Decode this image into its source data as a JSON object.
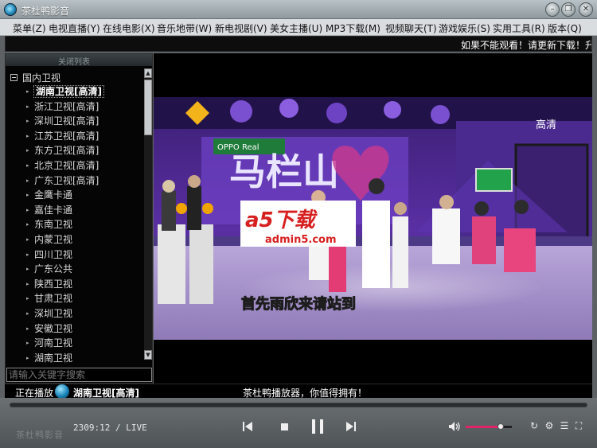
{
  "window": {
    "title": "茶杜鸭影音",
    "buttons": {
      "minimize": "–",
      "restore": "❐",
      "close": "✕"
    }
  },
  "menu": [
    "菜单(Z)",
    "电视直播(Y)",
    "在线电影(X)",
    "音乐地带(W)",
    "新电视剧(V)",
    "美女主播(U)",
    "MP3下载(M)",
    "视频聊天(T)",
    "游戏娱乐(S)",
    "实用工具(R)",
    "版本(Q)"
  ],
  "marquee": {
    "text": "如果不能观看！请更新下载！升级"
  },
  "sidebar": {
    "header": "关闭列表",
    "group": "国内卫视",
    "channels": [
      "湖南卫视[高清]",
      "浙江卫视[高清]",
      "深圳卫视[高清]",
      "江苏卫视[高清]",
      "东方卫视[高清]",
      "北京卫视[高清]",
      "广东卫视[高清]",
      "金鹰卡通",
      "嘉佳卡通",
      "东南卫视",
      "内蒙卫视",
      "四川卫视",
      "广东公共",
      "陕西卫视",
      "甘肃卫视",
      "深圳卫视",
      "安徽卫视",
      "河南卫视",
      "湖南卫视"
    ],
    "selected_index": 0,
    "search_placeholder": "请输入关键字搜索"
  },
  "video": {
    "hd_badge": "高清",
    "show_title": "马栏山",
    "sponsor": "OPPO Real",
    "subtitle": "首先雨欣来请站到",
    "watermark_logo": "a5下载",
    "watermark_url": "admin5.com"
  },
  "now_playing": {
    "label": "正在播放",
    "channel": "湖南卫视[高清]",
    "slogan": "茶杜鸭播放器，你值得拥有！"
  },
  "controls": {
    "time": "2309:12 / LIVE",
    "brand": "茶杜鸭影音",
    "volume_level": 0.75,
    "progress": 0,
    "icons": [
      "prev-icon",
      "stop-icon",
      "pause-icon",
      "next-icon",
      "volume-icon",
      "refresh-icon",
      "settings-icon",
      "playlist-icon",
      "fullscreen-icon"
    ]
  },
  "colors": {
    "accent": "#e0236a",
    "menu_bg": "#d9dddf",
    "panel_bg": "#050505",
    "subtitle": "#f5e04a"
  }
}
